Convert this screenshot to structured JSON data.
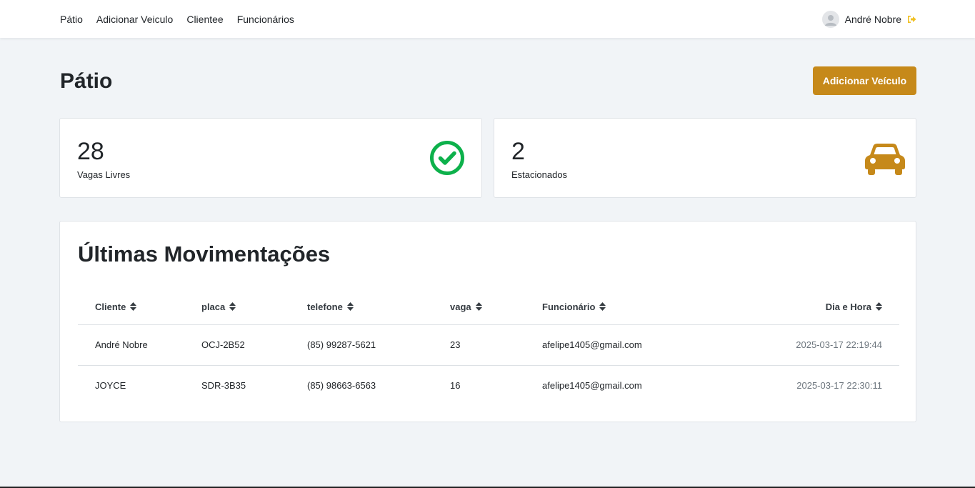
{
  "nav": {
    "links": [
      "Pátio",
      "Adicionar Veiculo",
      "Clientee",
      "Funcionários"
    ],
    "user_name": "André Nobre"
  },
  "page": {
    "title": "Pátio",
    "add_button": "Adicionar Veículo"
  },
  "stats": [
    {
      "value": "28",
      "label": "Vagas Livres",
      "icon": "check-circle-icon",
      "color": "#0db14b"
    },
    {
      "value": "2",
      "label": "Estacionados",
      "icon": "car-icon",
      "color": "#c6891a"
    }
  ],
  "movements": {
    "title": "Últimas Movimentações",
    "columns": [
      "Cliente",
      "placa",
      "telefone",
      "vaga",
      "Funcionário",
      "Dia e Hora"
    ],
    "rows": [
      [
        "André Nobre",
        "OCJ-2B52",
        "(85) 99287-5621",
        "23",
        "afelipe1405@gmail.com",
        "2025-03-17 22:19:44"
      ],
      [
        "JOYCE",
        "SDR-3B35",
        "(85) 98663-6563",
        "16",
        "afelipe1405@gmail.com",
        "2025-03-17 22:30:11"
      ]
    ]
  },
  "colors": {
    "accent": "#c6891a",
    "success": "#0db14b",
    "background": "#f1f4f7"
  }
}
